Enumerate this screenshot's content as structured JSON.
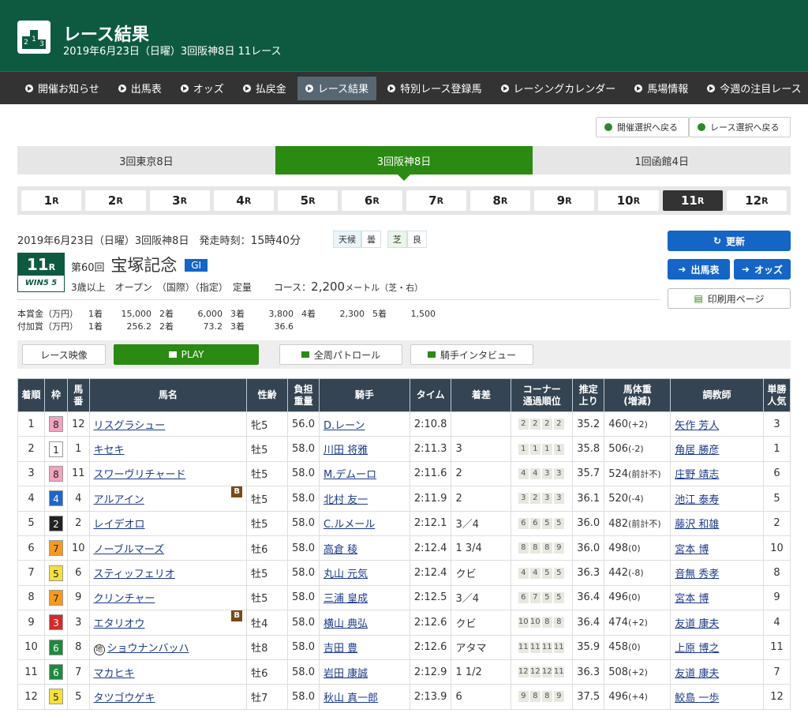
{
  "header": {
    "title": "レース結果",
    "subtitle": "2019年6月23日（日曜）3回阪神8日 11レース",
    "logo_digits": [
      "2",
      "1",
      "3"
    ]
  },
  "nav": [
    {
      "label": "開催お知らせ",
      "active": false
    },
    {
      "label": "出馬表",
      "active": false
    },
    {
      "label": "オッズ",
      "active": false
    },
    {
      "label": "払戻金",
      "active": false
    },
    {
      "label": "レース結果",
      "active": true
    },
    {
      "label": "特別レース登録馬",
      "active": false
    },
    {
      "label": "レーシングカレンダー",
      "active": false
    },
    {
      "label": "馬場情報",
      "active": false
    },
    {
      "label": "今週の注目レース",
      "active": false
    }
  ],
  "back": {
    "meeting": "開催選択へ戻る",
    "race": "レース選択へ戻る"
  },
  "venues": [
    {
      "label": "3回東京8日",
      "active": false
    },
    {
      "label": "3回阪神8日",
      "active": true
    },
    {
      "label": "1回函館4日",
      "active": false
    }
  ],
  "races": [
    {
      "num": "1",
      "suffix": "R"
    },
    {
      "num": "2",
      "suffix": "R"
    },
    {
      "num": "3",
      "suffix": "R"
    },
    {
      "num": "4",
      "suffix": "R"
    },
    {
      "num": "5",
      "suffix": "R"
    },
    {
      "num": "6",
      "suffix": "R"
    },
    {
      "num": "7",
      "suffix": "R"
    },
    {
      "num": "8",
      "suffix": "R"
    },
    {
      "num": "9",
      "suffix": "R"
    },
    {
      "num": "10",
      "suffix": "R"
    },
    {
      "num": "11",
      "suffix": "R",
      "active": true
    },
    {
      "num": "12",
      "suffix": "R"
    }
  ],
  "race": {
    "date_line": "2019年6月23日（日曜）3回阪神8日　発走時刻：",
    "start_time": "15時40分",
    "weather_label": "天候",
    "weather": "曇",
    "turf_label": "芝",
    "turf": "良",
    "number": "11",
    "number_suffix": "R",
    "win5": "WIN5 5",
    "edition": "第60回",
    "name": "宝塚記念",
    "grade": "GI",
    "conditions": "3歳以上　オープン　（国際）（指定）　定量",
    "course_label": "コース：",
    "distance": "2,200",
    "course_unit": "メートル（芝・右）",
    "prize_label": "本賞金（万円）",
    "prizes": [
      {
        "p": "1着",
        "v": "15,000"
      },
      {
        "p": "2着",
        "v": "6,000"
      },
      {
        "p": "3着",
        "v": "3,800"
      },
      {
        "p": "4着",
        "v": "2,300"
      },
      {
        "p": "5着",
        "v": "1,500"
      }
    ],
    "added_label": "付加賞（万円）",
    "added": [
      {
        "p": "1着",
        "v": "256.2"
      },
      {
        "p": "2着",
        "v": "73.2"
      },
      {
        "p": "3着",
        "v": "36.6"
      }
    ]
  },
  "side_buttons": {
    "refresh": "更新",
    "entries": "出馬表",
    "odds": "オッズ",
    "print": "印刷用ページ"
  },
  "video": {
    "label": "レース映像",
    "play": "PLAY",
    "patrol": "全周パトロール",
    "interview": "騎手インタビュー"
  },
  "table_headers": [
    "着順",
    "枠",
    "馬\n番",
    "馬名",
    "性齢",
    "負担\n重量",
    "騎手",
    "タイム",
    "着差",
    "コーナー\n通過順位",
    "推定\n上り",
    "馬体重\n(増減)",
    "調教師",
    "単勝\n人気"
  ],
  "waku_colors": {
    "1": "#ffffff",
    "2": "#222222",
    "3": "#d22b2b",
    "4": "#1e67c8",
    "5": "#f7e03a",
    "6": "#1f8a3d",
    "7": "#f59a1e",
    "8": "#f2a3bf"
  },
  "results": [
    {
      "rank": "1",
      "waku": "8",
      "num": "12",
      "horse": "リスグラシュー",
      "blinker": false,
      "sex_age": "牝5",
      "weight": "56.0",
      "jockey": "D.レーン",
      "time": "2:10.8",
      "margin": "",
      "corners": [
        "2",
        "2",
        "2",
        "2"
      ],
      "last3f": "35.2",
      "body": "460",
      "diff": "(+2)",
      "trainer": "矢作 芳人",
      "pop": "3"
    },
    {
      "rank": "2",
      "waku": "1",
      "num": "1",
      "horse": "キセキ",
      "blinker": false,
      "sex_age": "牡5",
      "weight": "58.0",
      "jockey": "川田 将雅",
      "time": "2:11.3",
      "margin": "3",
      "corners": [
        "1",
        "1",
        "1",
        "1"
      ],
      "last3f": "35.8",
      "body": "506",
      "diff": "(-2)",
      "trainer": "角居 勝彦",
      "pop": "1"
    },
    {
      "rank": "3",
      "waku": "8",
      "num": "11",
      "horse": "スワーヴリチャード",
      "blinker": false,
      "sex_age": "牡5",
      "weight": "58.0",
      "jockey": "M.デムーロ",
      "time": "2:11.6",
      "margin": "2",
      "corners": [
        "4",
        "4",
        "3",
        "3"
      ],
      "last3f": "35.7",
      "body": "524",
      "diff": "(前計不)",
      "trainer": "庄野 靖志",
      "pop": "6"
    },
    {
      "rank": "4",
      "waku": "4",
      "num": "4",
      "horse": "アルアイン",
      "blinker": true,
      "sex_age": "牡5",
      "weight": "58.0",
      "jockey": "北村 友一",
      "time": "2:11.9",
      "margin": "2",
      "corners": [
        "3",
        "2",
        "3",
        "3"
      ],
      "last3f": "36.1",
      "body": "520",
      "diff": "(-4)",
      "trainer": "池江 泰寿",
      "pop": "5"
    },
    {
      "rank": "5",
      "waku": "2",
      "num": "2",
      "horse": "レイデオロ",
      "blinker": false,
      "sex_age": "牡5",
      "weight": "58.0",
      "jockey": "C.ルメール",
      "time": "2:12.1",
      "margin": "3／4",
      "corners": [
        "6",
        "6",
        "5",
        "5"
      ],
      "last3f": "36.0",
      "body": "482",
      "diff": "(前計不)",
      "trainer": "藤沢 和雄",
      "pop": "2"
    },
    {
      "rank": "6",
      "waku": "7",
      "num": "10",
      "horse": "ノーブルマーズ",
      "blinker": false,
      "sex_age": "牡6",
      "weight": "58.0",
      "jockey": "高倉 稜",
      "time": "2:12.4",
      "margin": "1 3/4",
      "corners": [
        "8",
        "8",
        "8",
        "9"
      ],
      "last3f": "36.0",
      "body": "498",
      "diff": "(0)",
      "trainer": "宮本 博",
      "pop": "10"
    },
    {
      "rank": "7",
      "waku": "5",
      "num": "6",
      "horse": "スティッフェリオ",
      "blinker": false,
      "sex_age": "牡5",
      "weight": "58.0",
      "jockey": "丸山 元気",
      "time": "2:12.4",
      "margin": "クビ",
      "corners": [
        "4",
        "4",
        "5",
        "5"
      ],
      "last3f": "36.3",
      "body": "442",
      "diff": "(-8)",
      "trainer": "音無 秀孝",
      "pop": "8"
    },
    {
      "rank": "8",
      "waku": "7",
      "num": "9",
      "horse": "クリンチャー",
      "blinker": false,
      "sex_age": "牡5",
      "weight": "58.0",
      "jockey": "三浦 皇成",
      "time": "2:12.5",
      "margin": "3／4",
      "corners": [
        "6",
        "7",
        "5",
        "5"
      ],
      "last3f": "36.4",
      "body": "496",
      "diff": "(0)",
      "trainer": "宮本 博",
      "pop": "9"
    },
    {
      "rank": "9",
      "waku": "3",
      "num": "3",
      "horse": "エタリオウ",
      "blinker": true,
      "sex_age": "牡4",
      "weight": "58.0",
      "jockey": "横山 典弘",
      "time": "2:12.6",
      "margin": "クビ",
      "corners": [
        "10",
        "10",
        "8",
        "8"
      ],
      "last3f": "36.4",
      "body": "474",
      "diff": "(+2)",
      "trainer": "友道 康夫",
      "pop": "4"
    },
    {
      "rank": "10",
      "waku": "6",
      "num": "8",
      "horse": "ショウナンバッハ",
      "chi": "地",
      "blinker": false,
      "sex_age": "牡8",
      "weight": "58.0",
      "jockey": "吉田 豊",
      "time": "2:12.6",
      "margin": "アタマ",
      "corners": [
        "11",
        "11",
        "11",
        "11"
      ],
      "last3f": "35.9",
      "body": "458",
      "diff": "(0)",
      "trainer": "上原 博之",
      "pop": "11"
    },
    {
      "rank": "11",
      "waku": "6",
      "num": "7",
      "horse": "マカヒキ",
      "blinker": false,
      "sex_age": "牡6",
      "weight": "58.0",
      "jockey": "岩田 康誠",
      "time": "2:12.9",
      "margin": "1 1/2",
      "corners": [
        "12",
        "12",
        "12",
        "11"
      ],
      "last3f": "36.3",
      "body": "508",
      "diff": "(+2)",
      "trainer": "友道 康夫",
      "pop": "7"
    },
    {
      "rank": "12",
      "waku": "5",
      "num": "5",
      "horse": "タツゴウゲキ",
      "blinker": false,
      "sex_age": "牡7",
      "weight": "58.0",
      "jockey": "秋山 真一郎",
      "time": "2:13.9",
      "margin": "6",
      "corners": [
        "9",
        "8",
        "8",
        "9"
      ],
      "last3f": "37.5",
      "body": "496",
      "diff": "(+4)",
      "trainer": "鮫島 一歩",
      "pop": "12"
    }
  ]
}
